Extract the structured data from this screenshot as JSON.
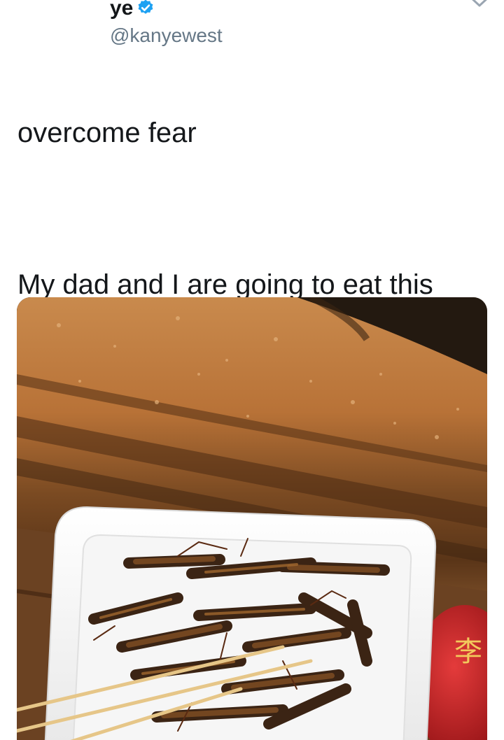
{
  "tweet": {
    "display_name": "ye",
    "handle": "@kanyewest",
    "verified": true,
    "line1": "overcome fear",
    "line2": "My dad and I are going to eat this plate of bugs to celebrate him beating cancer. No more fear"
  },
  "icons": {
    "verified": "verified-badge-icon",
    "caret": "chevron-down-icon"
  },
  "media": {
    "subject": "photo",
    "container_label": "李"
  },
  "colors": {
    "verified_blue": "#1da1f2",
    "handle_gray": "#657786",
    "text": "#14171a"
  }
}
